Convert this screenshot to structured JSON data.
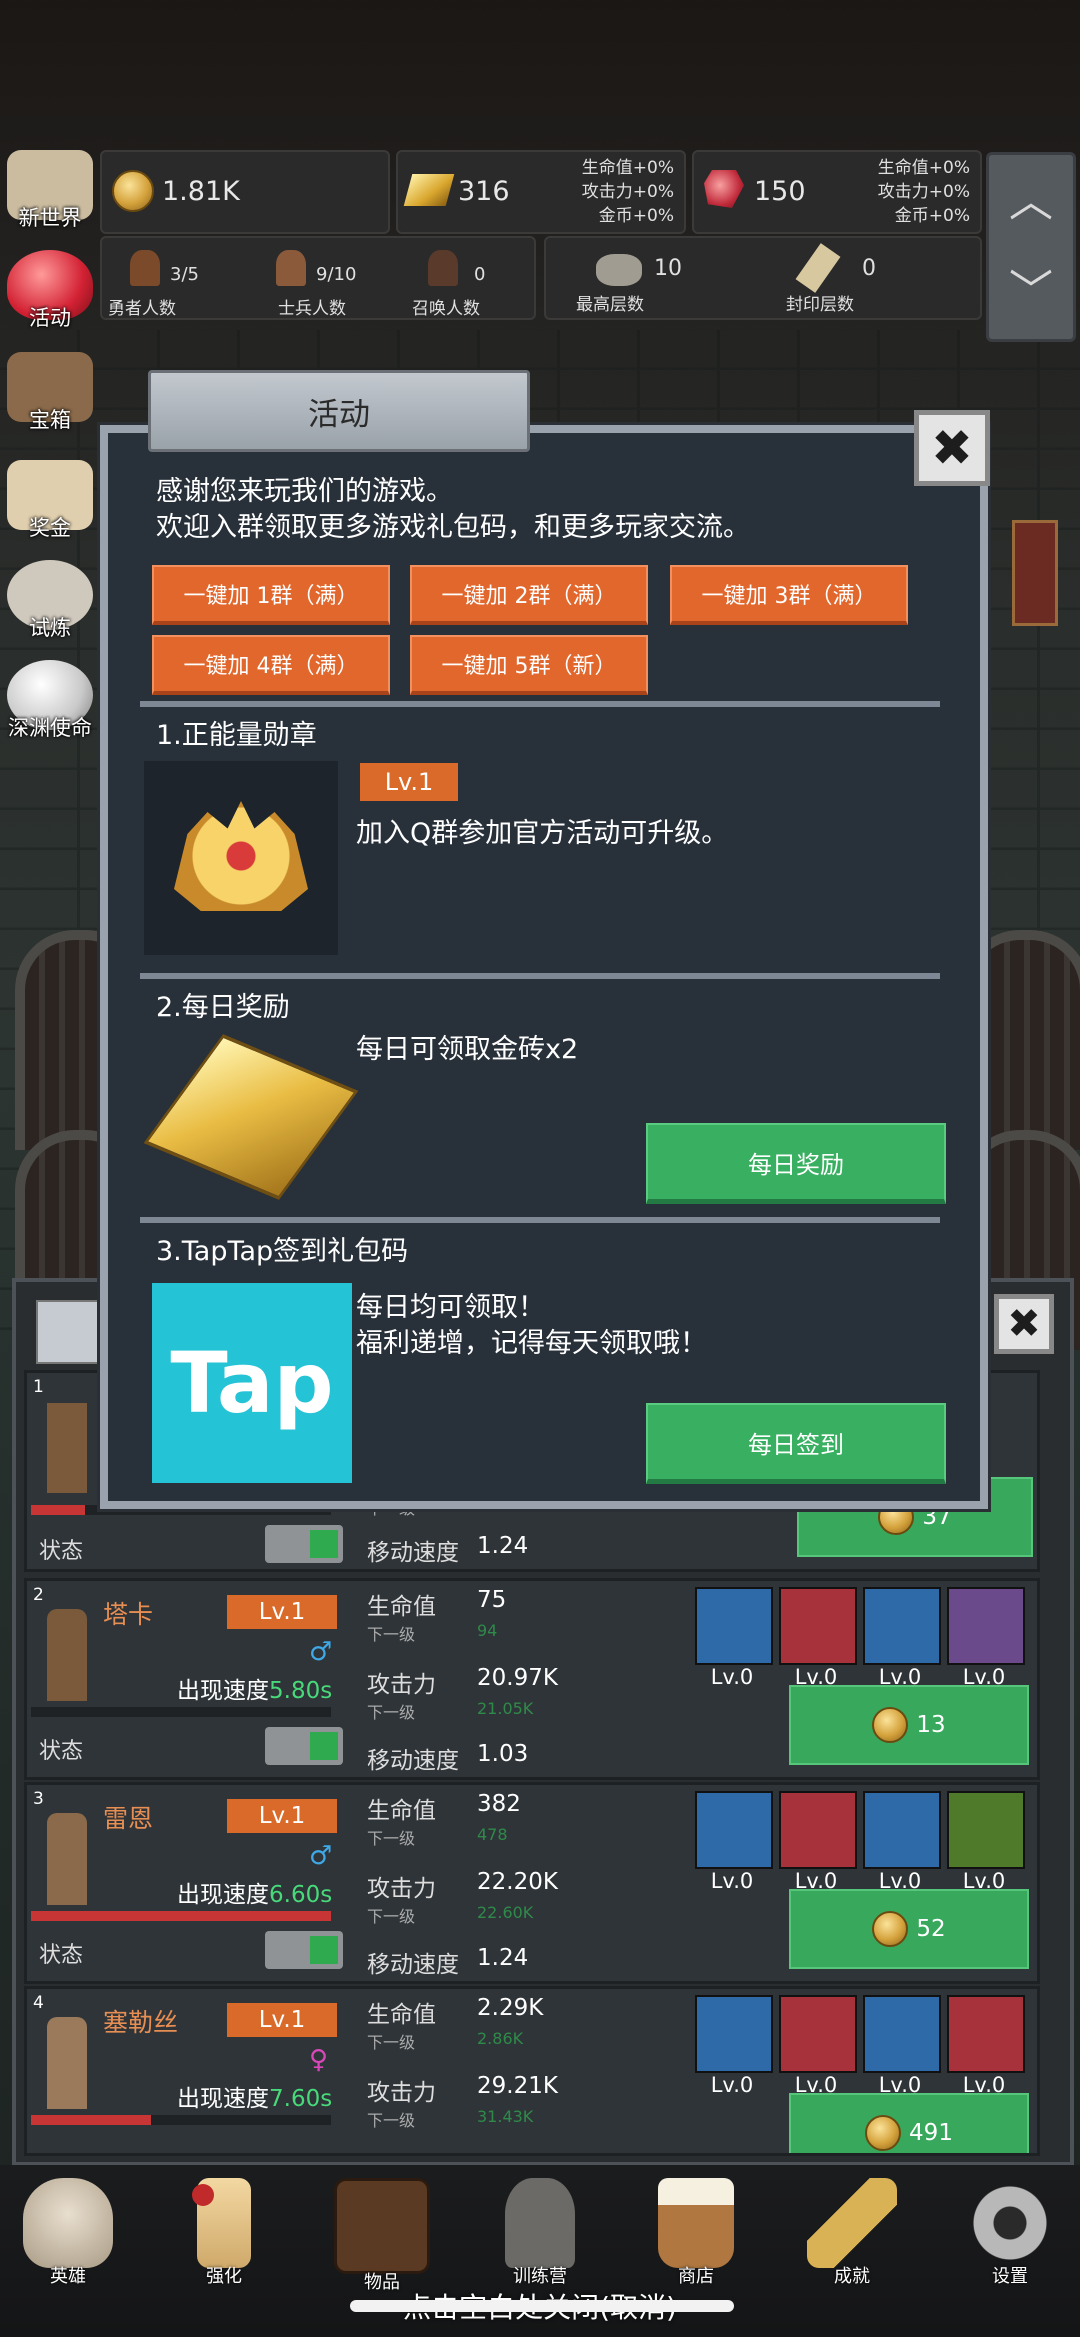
{
  "resources": {
    "gold": "1.81K",
    "goldbar": "316",
    "goldbar_bonus": [
      "生命值+0%",
      "攻击力+0%",
      "金币+0%"
    ],
    "gem": "150",
    "gem_bonus": [
      "生命值+0%",
      "攻击力+0%",
      "金币+0%"
    ]
  },
  "counts": [
    {
      "value": "3/5",
      "label": "勇者人数"
    },
    {
      "value": "9/10",
      "label": "士兵人数"
    },
    {
      "value": "0",
      "label": "召唤人数"
    }
  ],
  "floors": [
    {
      "value": "10",
      "label": "最高层数"
    },
    {
      "value": "0",
      "label": "封印层数"
    }
  ],
  "left_menu": [
    "新世界",
    "活动",
    "宝箱",
    "奖金",
    "试炼",
    "深渊使命"
  ],
  "modal": {
    "title": "活动",
    "close": "✖",
    "intro1": "感谢您来玩我们的游戏。",
    "intro2": "欢迎入群领取更多游戏礼包码，和更多玩家交流。",
    "groups": [
      "一键加 1群（满）",
      "一键加 2群（满）",
      "一键加 3群（满）",
      "一键加 4群（满）",
      "一键加 5群（新）"
    ],
    "s1_title": "1.正能量勋章",
    "s1_lv": "Lv.1",
    "s1_desc": "加入Q群参加官方活动可升级。",
    "s2_title": "2.每日奖励",
    "s2_desc": "每日可领取金砖x2",
    "s2_btn": "每日奖励",
    "s3_title": "3.TapTap签到礼包码",
    "s3_logo": "Tap",
    "s3_desc1": "每日均可领取！",
    "s3_desc2": "福利递增，记得每天领取哦！",
    "s3_btn": "每日签到"
  },
  "panel": {
    "close": "✖",
    "row1": {
      "num": "1",
      "sub_label": "下一级",
      "speed_label": "移动速度",
      "speed": "1.24",
      "state": "状态",
      "cost": "37"
    },
    "heroes": [
      {
        "num": "2",
        "name": "塔卡",
        "lv": "Lv.1",
        "spd_label": "出现速度",
        "spd": "5.80s",
        "hp": "75",
        "hp_next": "94",
        "atk": "20.97K",
        "atk_next": "21.05K",
        "move": "1.03",
        "cost": "13",
        "hpfill": 0
      },
      {
        "num": "3",
        "name": "雷恩",
        "lv": "Lv.1",
        "spd_label": "出现速度",
        "spd": "6.60s",
        "hp": "382",
        "hp_next": "478",
        "atk": "22.20K",
        "atk_next": "22.60K",
        "move": "1.24",
        "cost": "52",
        "hpfill": 1
      },
      {
        "num": "4",
        "name": "塞勒丝",
        "lv": "Lv.1",
        "spd_label": "出现速度",
        "spd": "7.60s",
        "hp": "2.29K",
        "hp_next": "2.86K",
        "atk": "29.21K",
        "atk_next": "31.43K",
        "move": "",
        "cost": "491",
        "hpfill": 0.4
      }
    ],
    "labels": {
      "hp": "生命值",
      "next": "下一级",
      "atk": "攻击力",
      "move": "移动速度",
      "state": "状态",
      "eq_lv": "Lv.0"
    }
  },
  "nav": [
    "英雄",
    "强化",
    "物品",
    "训练营",
    "商店",
    "成就",
    "设置"
  ],
  "bottom_hint": "点击空白处关闭(取消)"
}
